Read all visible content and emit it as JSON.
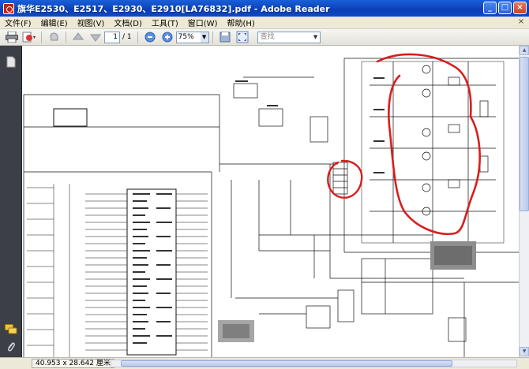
{
  "window": {
    "title": "旗华E2530、E2517、E2930、E2910[LA76832].pdf - Adobe Reader",
    "controls": [
      "_",
      "□",
      "×"
    ]
  },
  "menu": {
    "items": [
      "文件(F)",
      "编辑(E)",
      "视图(V)",
      "文档(D)",
      "工具(T)",
      "窗口(W)",
      "帮助(H)"
    ],
    "close_glyph": "×"
  },
  "toolbar": {
    "page_current": "1",
    "page_total": "/ 1",
    "zoom": "75%",
    "search_placeholder": "查找",
    "icons": [
      "print-icon",
      "email-pdf-icon",
      "hand-tool-icon",
      "page-up-icon",
      "page-down-icon",
      "zoom-out-icon",
      "zoom-in-icon",
      "save-copy-icon",
      "fit-page-icon"
    ]
  },
  "leftpanel": {
    "icons": [
      "pages-icon",
      "comments-icon",
      "attachments-icon"
    ]
  },
  "status": {
    "dimensions": "40.953 x 28.642 厘米"
  },
  "colors": {
    "titlebar": "#0a3fb6",
    "annotation_red": "#d81e1e",
    "panel_dark": "#3c3f45"
  }
}
